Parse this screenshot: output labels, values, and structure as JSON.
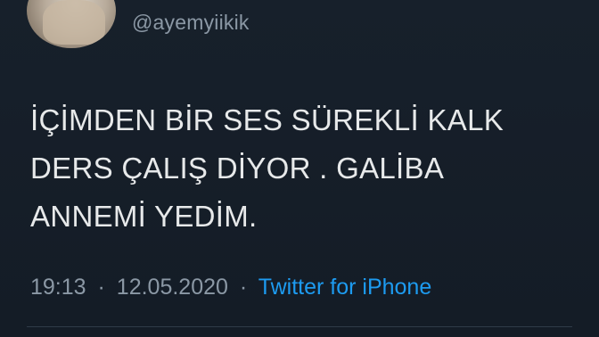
{
  "user": {
    "handle": "@ayemyiikik"
  },
  "tweet": {
    "lines": [
      "İÇİMDEN BİR SES SÜREKLİ KALK",
      "DERS ÇALIŞ DİYOR . GALİBA",
      "ANNEMİ YEDİM."
    ],
    "time": "19:13",
    "separator": "·",
    "date": "12.05.2020",
    "source": "Twitter for iPhone"
  },
  "colors": {
    "background": "#151e28",
    "text": "#e7e9ea",
    "muted": "#8b98a5",
    "link": "#1d9bf0"
  }
}
